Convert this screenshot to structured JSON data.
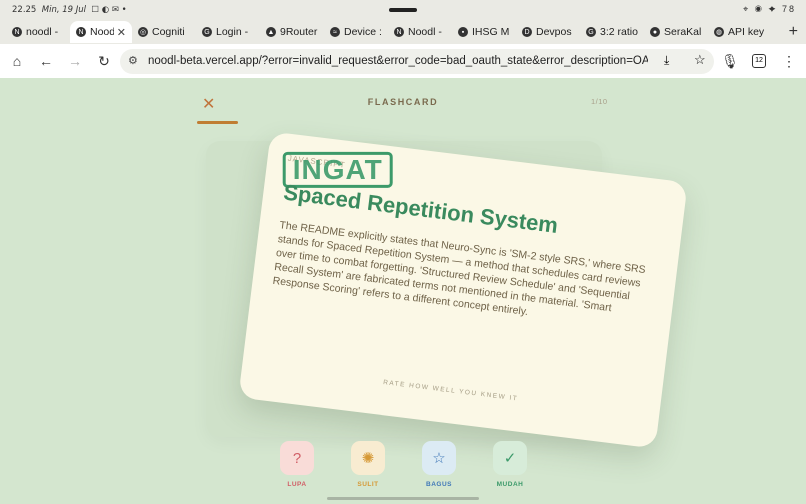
{
  "status": {
    "time": "22.25",
    "date": "Min, 19 Jul",
    "notif_icons": "☐ ◐ ✉ •",
    "right_icons": "⌖ ◉ ✦ 78"
  },
  "tabs": [
    {
      "label": "noodl -",
      "icon": "N"
    },
    {
      "label": "Noodl",
      "icon": "N",
      "active": true
    },
    {
      "label": "Cogniti",
      "icon": "◎"
    },
    {
      "label": "Login -",
      "icon": "G"
    },
    {
      "label": "9Router",
      "icon": "▲"
    },
    {
      "label": "Device :",
      "icon": "≈"
    },
    {
      "label": "Noodl -",
      "icon": "N"
    },
    {
      "label": "IHSG M",
      "icon": "▪"
    },
    {
      "label": "Devpos",
      "icon": "D"
    },
    {
      "label": "3:2 ratio",
      "icon": "G"
    },
    {
      "label": "SeraKal",
      "icon": "●"
    },
    {
      "label": "API key",
      "icon": "◍"
    }
  ],
  "toolbar": {
    "url": "noodl-beta.vercel.app/?error=invalid_request&error_code=bad_oauth_state&error_description=OAuth",
    "tab_count": "12"
  },
  "app": {
    "close_label": "✕",
    "title": "FLASHCARD",
    "counter": "1/10",
    "progress_fraction": 0.1,
    "card": {
      "topic": "JAVASCRIPT",
      "stamp": "INGAT",
      "term": "Spaced Repetition System",
      "explanation": "The README explicitly states that Neuro-Sync is 'SM-2 style SRS,' where SRS stands for Spaced Repetition System — a method that schedules card reviews over time to combat forgetting. 'Structured Review Schedule' and 'Sequential Recall System' are fabricated terms not mentioned in the material. 'Smart Response Scoring' refers to a different concept entirely.",
      "rate_hint": "RATE HOW WELL YOU KNEW IT"
    },
    "actions": [
      {
        "label": "LUPA",
        "icon": "question-circle-icon",
        "glyph": "?"
      },
      {
        "label": "SULIT",
        "icon": "brain-icon",
        "glyph": "✺"
      },
      {
        "label": "BAGUS",
        "icon": "star-icon",
        "glyph": "☆"
      },
      {
        "label": "MUDAH",
        "icon": "check-icon",
        "glyph": "✓"
      }
    ]
  },
  "colors": {
    "background": "#d4e6cf",
    "card": "#fbf8e6",
    "accent_green": "#3c9a6a",
    "progress": "#c07d32"
  }
}
